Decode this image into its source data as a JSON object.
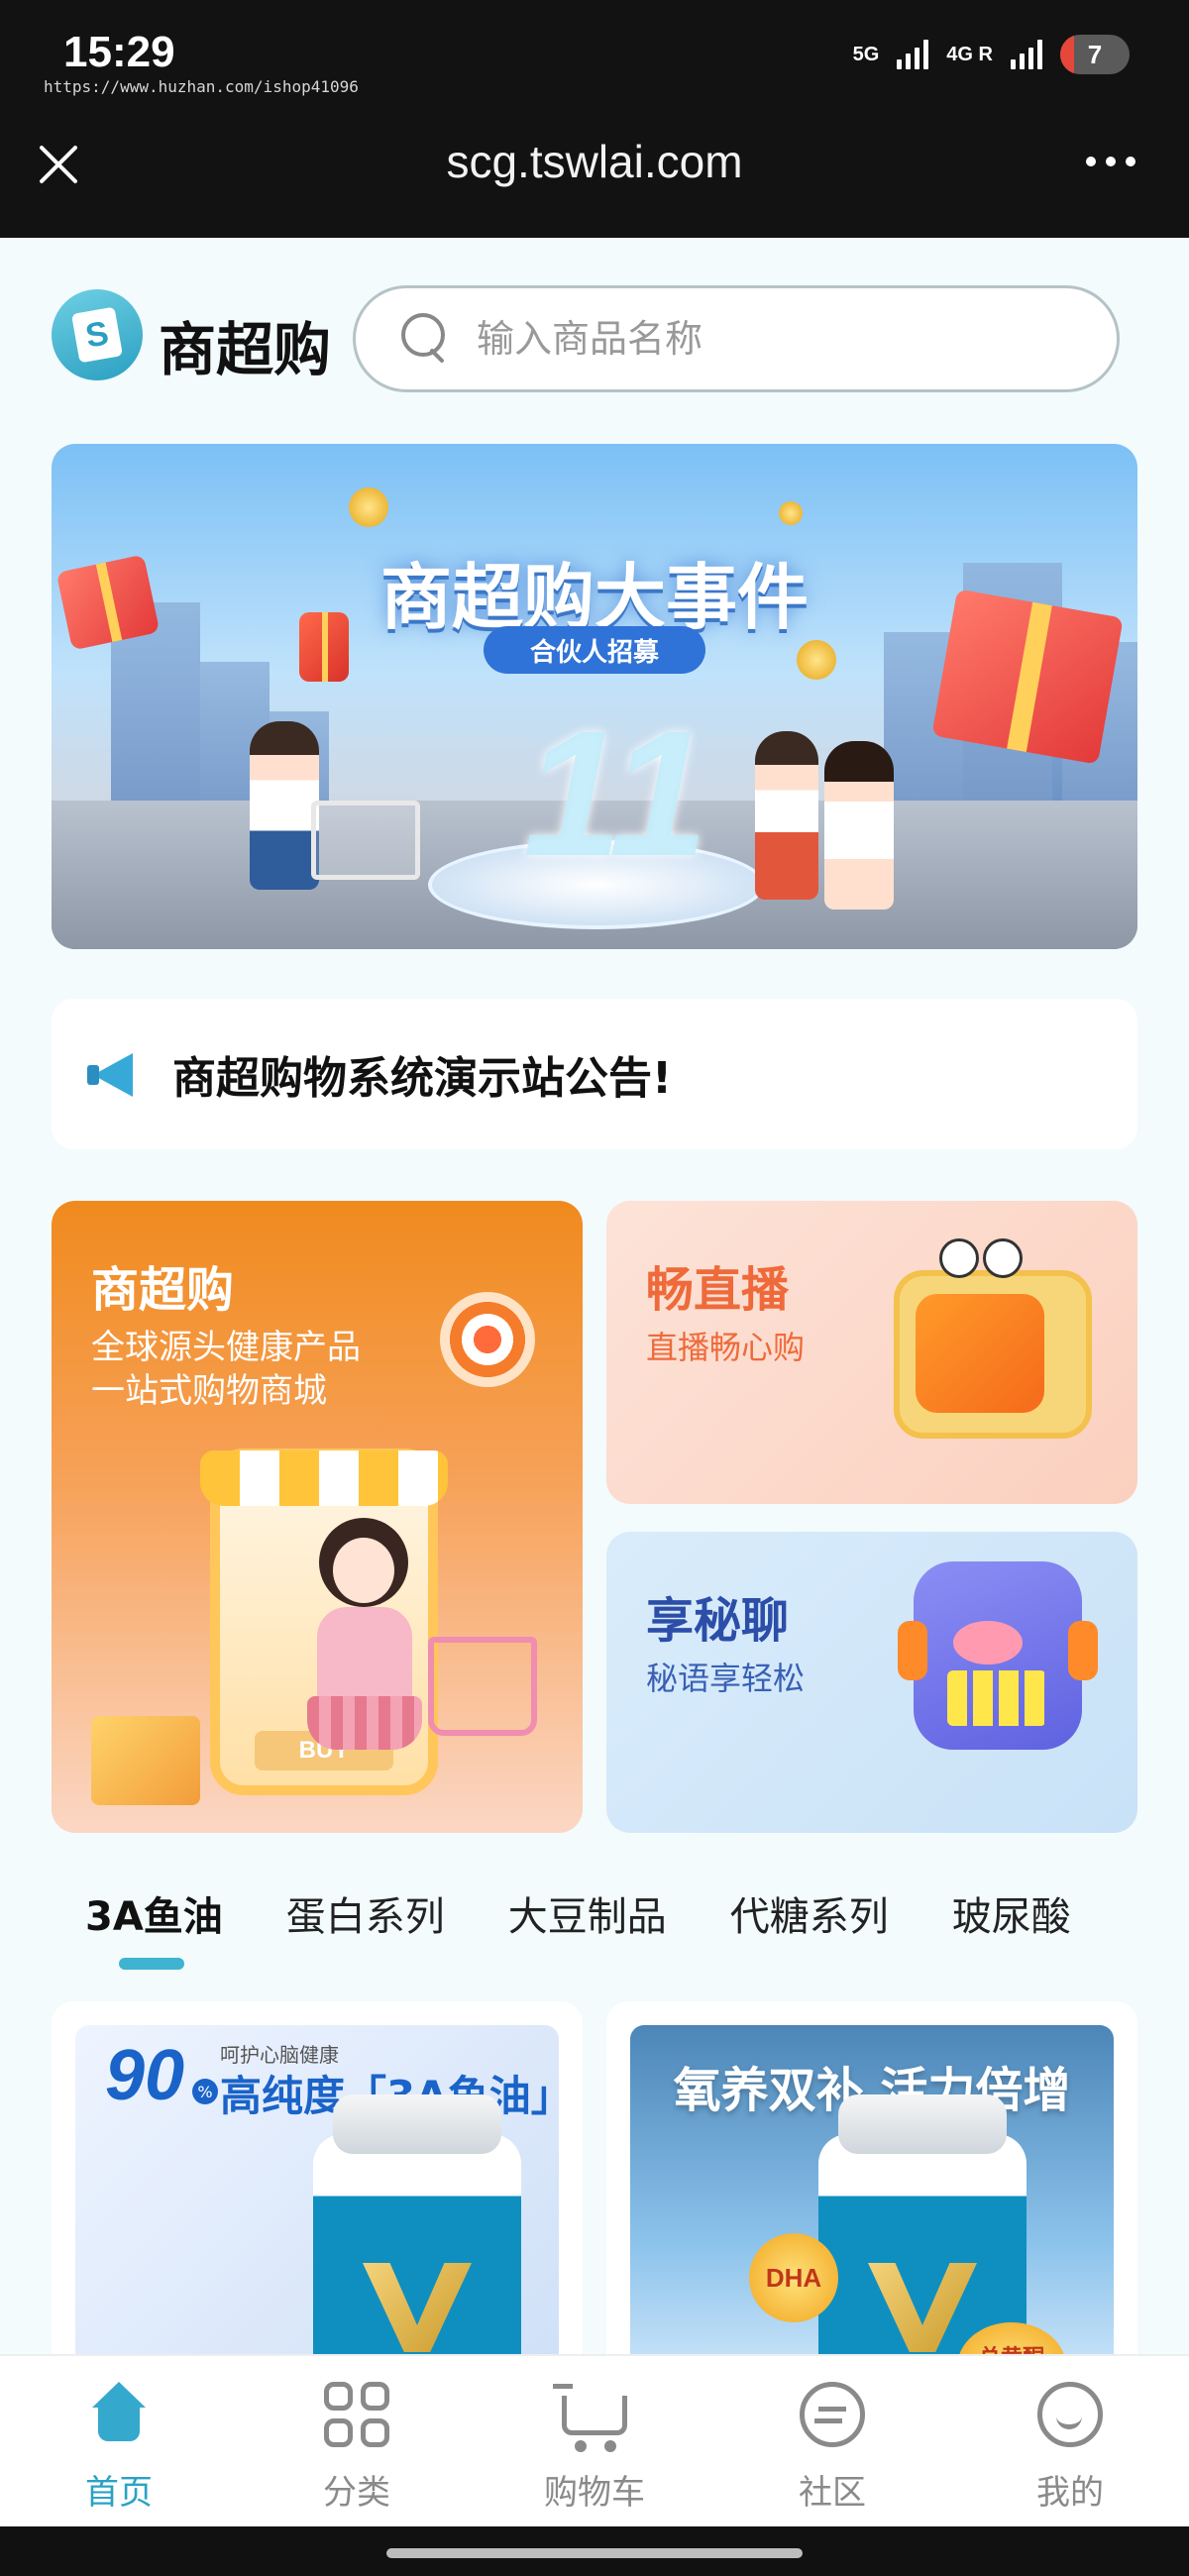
{
  "status_bar": {
    "time": "15:29",
    "watermark": "https://www.huzhan.com/ishop41096",
    "network_1": "5G",
    "network_2": "4G",
    "network_2_sup": "R",
    "battery": "7"
  },
  "browser": {
    "url": "scg.tswlai.com",
    "close_icon": "close-icon",
    "more_icon": "more-icon"
  },
  "header": {
    "brand": "商超购",
    "logo_letter": "S",
    "search_placeholder": "输入商品名称"
  },
  "banner": {
    "title": "商超购大事件",
    "pill": "合伙人招募",
    "big_number": "11"
  },
  "notice": {
    "text": "商超购物系统演示站公告!"
  },
  "features": {
    "main": {
      "title": "商超购",
      "line1": "全球源头健康产品",
      "line2": "一站式购物商城",
      "buy": "BUY"
    },
    "live": {
      "title": "畅直播",
      "subtitle": "直播畅心购"
    },
    "chat": {
      "title": "享秘聊",
      "subtitle": "秘语享轻松"
    }
  },
  "tabs": [
    "3A鱼油",
    "蛋白系列",
    "大豆制品",
    "代糖系列",
    "玻尿酸"
  ],
  "active_tab": "3A鱼油",
  "products": [
    {
      "percent": "90",
      "percent_sign": "%",
      "tagline": "呵护心脑健康",
      "headline": "高纯度「3A鱼油」"
    },
    {
      "headline": "氧养双补 活力倍增",
      "badge_1": "DHA",
      "badge_2": "总黄酮"
    }
  ],
  "bottom_nav": [
    {
      "label": "首页",
      "icon": "home-icon",
      "active": true
    },
    {
      "label": "分类",
      "icon": "grid-icon",
      "active": false
    },
    {
      "label": "购物车",
      "icon": "cart-icon",
      "active": false
    },
    {
      "label": "社区",
      "icon": "chat-icon",
      "active": false
    },
    {
      "label": "我的",
      "icon": "smile-icon",
      "active": false
    }
  ],
  "colors": {
    "accent": "#2aa2c4",
    "main_card": "#f08a1e",
    "live_title": "#ef6a3a",
    "chat_title": "#2c4ea8"
  }
}
